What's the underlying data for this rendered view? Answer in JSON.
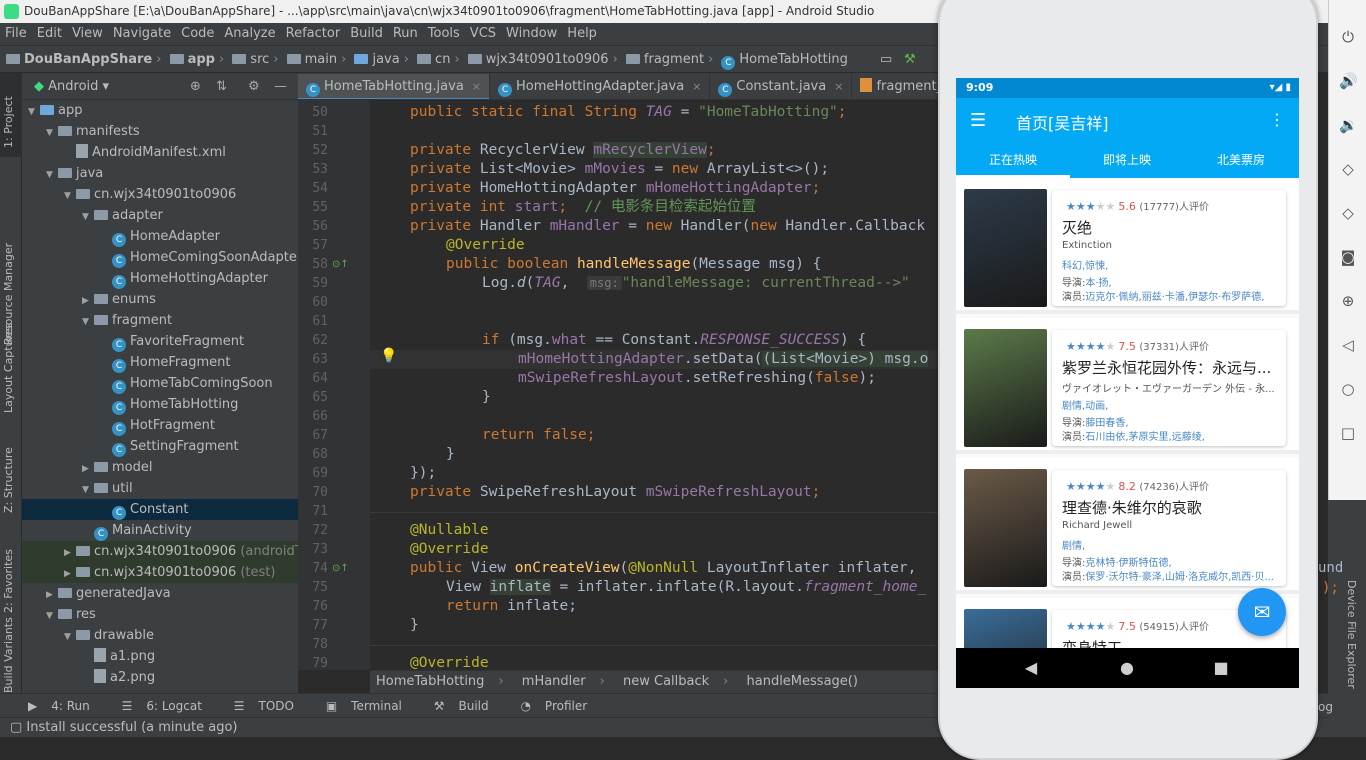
{
  "window": {
    "title": "DouBanAppShare [E:\\a\\DouBanAppShare] - ...\\app\\src\\main\\java\\cn\\wjx34t0901to0906\\fragment\\HomeTabHotting.java [app] - Android Studio"
  },
  "menu": [
    "File",
    "Edit",
    "View",
    "Navigate",
    "Code",
    "Analyze",
    "Refactor",
    "Build",
    "Run",
    "Tools",
    "VCS",
    "Window",
    "Help"
  ],
  "nav": [
    "DouBanAppShare",
    "app",
    "src",
    "main",
    "java",
    "cn",
    "wjx34t0901to0906",
    "fragment",
    "HomeTabHotting"
  ],
  "left_tools": {
    "project": "1: Project",
    "resource": "Resource Manager",
    "captures": "Layout Captures",
    "structure": "Z: Structure",
    "favorites": "2: Favorites",
    "variants": "Build Variants"
  },
  "project_panel": {
    "mode": "Android"
  },
  "tree": [
    {
      "label": "app",
      "indent": 0,
      "open": true,
      "kind": "folder"
    },
    {
      "label": "manifests",
      "indent": 1,
      "open": true,
      "kind": "folder"
    },
    {
      "label": "AndroidManifest.xml",
      "indent": 2,
      "kind": "file"
    },
    {
      "label": "java",
      "indent": 1,
      "open": true,
      "kind": "folder"
    },
    {
      "label": "cn.wjx34t0901to0906",
      "indent": 2,
      "open": true,
      "kind": "folder"
    },
    {
      "label": "adapter",
      "indent": 3,
      "open": true,
      "kind": "folder"
    },
    {
      "label": "HomeAdapter",
      "indent": 4,
      "kind": "class"
    },
    {
      "label": "HomeComingSoonAdapter",
      "indent": 4,
      "kind": "class"
    },
    {
      "label": "HomeHottingAdapter",
      "indent": 4,
      "kind": "class"
    },
    {
      "label": "enums",
      "indent": 3,
      "open": false,
      "kind": "folder"
    },
    {
      "label": "fragment",
      "indent": 3,
      "open": true,
      "kind": "folder"
    },
    {
      "label": "FavoriteFragment",
      "indent": 4,
      "kind": "class"
    },
    {
      "label": "HomeFragment",
      "indent": 4,
      "kind": "class"
    },
    {
      "label": "HomeTabComingSoon",
      "indent": 4,
      "kind": "class"
    },
    {
      "label": "HomeTabHotting",
      "indent": 4,
      "kind": "class"
    },
    {
      "label": "HotFragment",
      "indent": 4,
      "kind": "class"
    },
    {
      "label": "SettingFragment",
      "indent": 4,
      "kind": "class"
    },
    {
      "label": "model",
      "indent": 3,
      "open": false,
      "kind": "folder"
    },
    {
      "label": "util",
      "indent": 3,
      "open": true,
      "kind": "folder"
    },
    {
      "label": "Constant",
      "indent": 4,
      "kind": "class",
      "selected": true
    },
    {
      "label": "MainActivity",
      "indent": 3,
      "kind": "class"
    },
    {
      "label": "cn.wjx34t0901to0906",
      "suffix": "(androidTest)",
      "indent": 2,
      "open": false,
      "kind": "folder",
      "mod": true
    },
    {
      "label": "cn.wjx34t0901to0906",
      "suffix": "(test)",
      "indent": 2,
      "open": false,
      "kind": "folder",
      "mod": true
    },
    {
      "label": "generatedJava",
      "indent": 1,
      "open": false,
      "kind": "folder"
    },
    {
      "label": "res",
      "indent": 1,
      "open": true,
      "kind": "folder"
    },
    {
      "label": "drawable",
      "indent": 2,
      "open": true,
      "kind": "folder"
    },
    {
      "label": "a1.png",
      "indent": 3,
      "kind": "file"
    },
    {
      "label": "a2.png",
      "indent": 3,
      "kind": "file"
    }
  ],
  "editor_tabs": [
    {
      "label": "HomeTabHotting.java",
      "active": true
    },
    {
      "label": "HomeHottingAdapter.java"
    },
    {
      "label": "Constant.java"
    },
    {
      "label": "fragment_home_ta"
    }
  ],
  "line_numbers": [
    "50",
    "51",
    "52",
    "53",
    "54",
    "55",
    "56",
    "57",
    "58",
    "59",
    "60",
    "61",
    "62",
    "63",
    "64",
    "65",
    "66",
    "67",
    "68",
    "69",
    "70",
    "71",
    "72",
    "73",
    "74",
    "75",
    "76",
    "77",
    "78",
    "79"
  ],
  "code": {
    "l50": [
      "public static final String ",
      "TAG",
      " = ",
      "\"HomeTabHotting\"",
      ";"
    ],
    "l52": [
      "private ",
      "RecyclerView ",
      "mRecyclerView",
      ";"
    ],
    "l53": [
      "private ",
      "List<Movie> ",
      "mMovies",
      " = ",
      "new ",
      "ArrayList<>();"
    ],
    "l54": [
      "private ",
      "HomeHottingAdapter ",
      "mHomeHottingAdapter",
      ";"
    ],
    "l55": [
      "private int ",
      "start",
      ";  ",
      "// 电影条目检索起始位置"
    ],
    "l56": [
      "private ",
      "Handler ",
      "mHandler",
      " = ",
      "new ",
      "Handler(",
      "new ",
      "Handler.Callback"
    ],
    "l57": [
      "@Override"
    ],
    "l58": [
      "public boolean ",
      "handleMessage",
      "(Message msg) {"
    ],
    "l59": [
      "Log.",
      "d",
      "(",
      "TAG",
      ",  ",
      "msg:",
      "\"handleMessage: currentThread-->\""
    ],
    "l62": [
      "if ",
      "(msg.",
      "what",
      " == Constant.",
      "RESPONSE_SUCCESS",
      ") {"
    ],
    "l63": [
      "mHomeHottingAdapter",
      ".setData(",
      "(List<Movie>) msg.o"
    ],
    "l64": [
      "mSwipeRefreshLayout",
      ".setRefreshing(",
      "false",
      ");"
    ],
    "l65": [
      "}"
    ],
    "l67": [
      "return ",
      "false",
      ";"
    ],
    "l68": [
      "}"
    ],
    "l69": [
      "});"
    ],
    "l70": [
      "private ",
      "SwipeRefreshLayout ",
      "mSwipeRefreshLayout",
      ";"
    ],
    "l72": [
      "@Nullable"
    ],
    "l73": [
      "@Override"
    ],
    "l74": [
      "public ",
      "View ",
      "onCreateView",
      "(",
      "@NonNull ",
      "LayoutInflater inflater,"
    ],
    "l75": [
      "View ",
      "inflate",
      " = inflater.inflate(R.layout.",
      "fragment_home_"
    ],
    "l76": [
      "return ",
      "inflate;"
    ],
    "l77": [
      "}"
    ],
    "l79": [
      "@Override"
    ]
  },
  "breadcrumb": [
    "HomeTabHotting",
    "mHandler",
    "new Callback",
    "handleMessage()"
  ],
  "bottom_tools": [
    "4: Run",
    "6: Logcat",
    "TODO",
    "Terminal",
    "Build",
    "Profiler"
  ],
  "status": "Install successful (a minute ago)",
  "right_tools": {
    "device_explorer": "Device File Explorer",
    "snippet1": "und",
    "snippet2": ");",
    "snippet3": "og"
  },
  "phone": {
    "time": "9:09",
    "title": "首页[吴吉祥]",
    "tabs": [
      "正在热映",
      "即将上映",
      "北美票房"
    ],
    "movies": [
      {
        "stars": 3,
        "score": "5.6",
        "count": "(17777)人评价",
        "title": "灭绝",
        "subtitle": "Extinction",
        "genres": "科幻,惊悚,",
        "director_label": "导演:",
        "director": "本·扬,",
        "actors_label": "演员:",
        "actors": "迈克尔·佩纳,丽兹·卡潘,伊瑟尔·布罗萨德,",
        "poster": "#2d3b4a"
      },
      {
        "stars": 4,
        "score": "7.5",
        "count": "(37331)人评价",
        "title": "紫罗兰永恒花园外传：永远与...",
        "subtitle": "ヴァイオレット・エヴァーガーデン 外伝 - 永...",
        "genres": "剧情,动画,",
        "director_label": "导演:",
        "director": "藤田春香,",
        "actors_label": "演员:",
        "actors": "石川由依,茅原实里,远藤绫,",
        "poster": "#5b7a4a"
      },
      {
        "stars": 4,
        "score": "8.2",
        "count": "(74236)人评价",
        "title": "理查德·朱维尔的哀歌",
        "subtitle": "Richard Jewell",
        "genres": "剧情,",
        "director_label": "导演:",
        "director": "克林特·伊斯特伍德,",
        "actors_label": "演员:",
        "actors": "保罗·沃尔特·豪泽,山姆·洛克威尔,凯西·贝...",
        "poster": "#6b5a48"
      },
      {
        "stars": 4,
        "score": "7.5",
        "count": "(54915)人评价",
        "title": "变身特工",
        "poster": "#3a6d9a"
      }
    ],
    "colors": {
      "primary": "#03a9f4",
      "dark": "#0288d1",
      "fab": "#2196f3",
      "star": "#4a88c7",
      "score": "#d9534f"
    }
  }
}
